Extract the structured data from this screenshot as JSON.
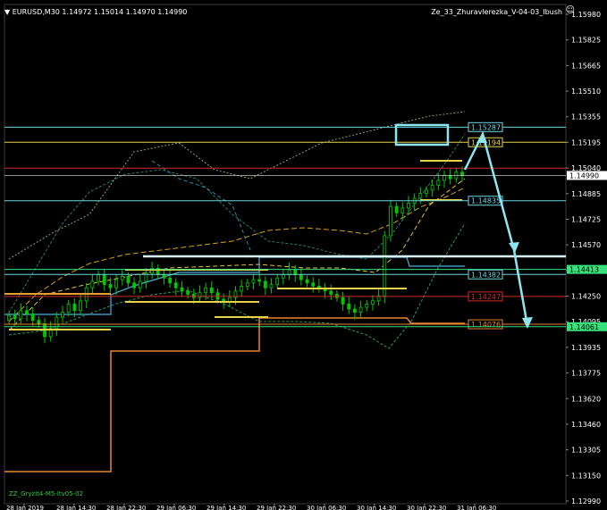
{
  "header": {
    "symbol_line": "EURUSD,M30  1.14972 1.15014 1.14970 1.14990",
    "indicator_name": "Ze_33_Zhuravlerezka_V-04-03_Ibush"
  },
  "footer": {
    "indicator_label": "ZZ_Gryzit4-M5-ltv05-02"
  },
  "colors": {
    "background": "#000000",
    "grid": "#1e3a3a",
    "candle": "#00c800",
    "level_cyan": "#6bd6e0",
    "level_yellow": "#e6d34a",
    "level_red": "#d22a2a",
    "level_orange": "#e8842e",
    "level_green": "#36e07a",
    "arrow": "#8ee6f0"
  },
  "price_axis": {
    "labels": [
      "1.15980",
      "1.15825",
      "1.15665",
      "1.15510",
      "1.15355",
      "1.15195",
      "1.15040",
      "1.14885",
      "1.14725",
      "1.14570",
      "1.14415",
      "1.14250",
      "1.14095",
      "1.13935",
      "1.13775",
      "1.13620",
      "1.13460",
      "1.13305",
      "1.13150",
      "1.12990"
    ],
    "current_price": "1.14990",
    "current_price_bg": "#d22a2a",
    "min": 1.1299,
    "max": 1.1598
  },
  "time_axis": {
    "labels": [
      "28 Jan 2019",
      "28 Jan 14:30",
      "28 Jan 22:30",
      "29 Jan 06:30",
      "29 Jan 14:30",
      "29 Jan 22:30",
      "30 Jan 06:30",
      "30 Jan 14:30",
      "30 Jan 22:30",
      "31 Jan 06:30"
    ]
  },
  "levels": [
    {
      "label": "1.15287",
      "price": 1.15287,
      "color": "#6bd6e0"
    },
    {
      "label": "1.15194",
      "price": 1.15194,
      "color": "#e6d34a"
    },
    {
      "label": "1.14835",
      "price": 1.14835,
      "color": "#6bd6e0"
    },
    {
      "label": "1.14413",
      "price": 1.14413,
      "color": "#36e07a",
      "right_badge": true
    },
    {
      "label": "1.14382",
      "price": 1.14382,
      "color": "#6bd6e0"
    },
    {
      "label": "1.14247",
      "price": 1.14247,
      "color": "#d22a2a"
    },
    {
      "label": "1.14076",
      "price": 1.14076,
      "color": "#e8842e"
    },
    {
      "label": "1.14061",
      "price": 1.14061,
      "color": "#36e07a",
      "right_badge": true
    }
  ]
}
